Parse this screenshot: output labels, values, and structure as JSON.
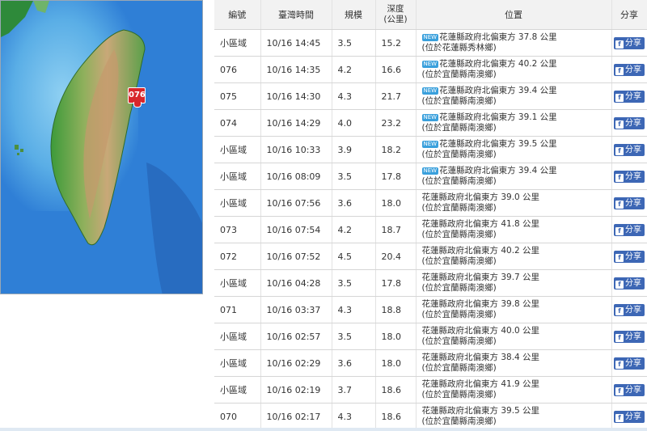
{
  "map": {
    "marker_label": "076",
    "colors": {
      "sea": "#2f7fd6",
      "shallow": "#7cc3ee",
      "lowland": "#3d9a3a",
      "highland": "#c9a878",
      "marker": "#d8262b"
    }
  },
  "table": {
    "headers": {
      "id": "編號",
      "time": "臺灣時間",
      "magnitude": "規模",
      "depth_line1": "深度",
      "depth_line2": "(公里)",
      "location": "位置",
      "share": "分享"
    },
    "new_badge_text": "NEW",
    "share_label": "分享",
    "rows": [
      {
        "id": "小區域",
        "time": "10/16 14:45",
        "magnitude": "3.5",
        "depth": "15.2",
        "loc1": "花蓮縣政府北偏東方 37.8 公里",
        "loc2": "(位於花蓮縣秀林鄉)",
        "is_new": true
      },
      {
        "id": "076",
        "time": "10/16 14:35",
        "magnitude": "4.2",
        "depth": "16.6",
        "loc1": "花蓮縣政府北偏東方 40.2 公里",
        "loc2": "(位於宜蘭縣南澳鄉)",
        "is_new": true
      },
      {
        "id": "075",
        "time": "10/16 14:30",
        "magnitude": "4.3",
        "depth": "21.7",
        "loc1": "花蓮縣政府北偏東方 39.4 公里",
        "loc2": "(位於宜蘭縣南澳鄉)",
        "is_new": true
      },
      {
        "id": "074",
        "time": "10/16 14:29",
        "magnitude": "4.0",
        "depth": "23.2",
        "loc1": "花蓮縣政府北偏東方 39.1 公里",
        "loc2": "(位於宜蘭縣南澳鄉)",
        "is_new": true
      },
      {
        "id": "小區域",
        "time": "10/16 10:33",
        "magnitude": "3.9",
        "depth": "18.2",
        "loc1": "花蓮縣政府北偏東方 39.5 公里",
        "loc2": "(位於宜蘭縣南澳鄉)",
        "is_new": true
      },
      {
        "id": "小區域",
        "time": "10/16 08:09",
        "magnitude": "3.5",
        "depth": "17.8",
        "loc1": "花蓮縣政府北偏東方 39.4 公里",
        "loc2": "(位於宜蘭縣南澳鄉)",
        "is_new": true
      },
      {
        "id": "小區域",
        "time": "10/16 07:56",
        "magnitude": "3.6",
        "depth": "18.0",
        "loc1": "花蓮縣政府北偏東方 39.0 公里",
        "loc2": "(位於宜蘭縣南澳鄉)",
        "is_new": false
      },
      {
        "id": "073",
        "time": "10/16 07:54",
        "magnitude": "4.2",
        "depth": "18.7",
        "loc1": "花蓮縣政府北偏東方 41.8 公里",
        "loc2": "(位於宜蘭縣南澳鄉)",
        "is_new": false
      },
      {
        "id": "072",
        "time": "10/16 07:52",
        "magnitude": "4.5",
        "depth": "20.4",
        "loc1": "花蓮縣政府北偏東方 40.2 公里",
        "loc2": "(位於宜蘭縣南澳鄉)",
        "is_new": false
      },
      {
        "id": "小區域",
        "time": "10/16 04:28",
        "magnitude": "3.5",
        "depth": "17.8",
        "loc1": "花蓮縣政府北偏東方 39.7 公里",
        "loc2": "(位於宜蘭縣南澳鄉)",
        "is_new": false
      },
      {
        "id": "071",
        "time": "10/16 03:37",
        "magnitude": "4.3",
        "depth": "18.8",
        "loc1": "花蓮縣政府北偏東方 39.8 公里",
        "loc2": "(位於宜蘭縣南澳鄉)",
        "is_new": false
      },
      {
        "id": "小區域",
        "time": "10/16 02:57",
        "magnitude": "3.5",
        "depth": "18.0",
        "loc1": "花蓮縣政府北偏東方 40.0 公里",
        "loc2": "(位於宜蘭縣南澳鄉)",
        "is_new": false
      },
      {
        "id": "小區域",
        "time": "10/16 02:29",
        "magnitude": "3.6",
        "depth": "18.0",
        "loc1": "花蓮縣政府北偏東方 38.4 公里",
        "loc2": "(位於宜蘭縣南澳鄉)",
        "is_new": false
      },
      {
        "id": "小區域",
        "time": "10/16 02:19",
        "magnitude": "3.7",
        "depth": "18.6",
        "loc1": "花蓮縣政府北偏東方 41.9 公里",
        "loc2": "(位於宜蘭縣南澳鄉)",
        "is_new": false
      },
      {
        "id": "070",
        "time": "10/16 02:17",
        "magnitude": "4.3",
        "depth": "18.6",
        "loc1": "花蓮縣政府北偏東方 39.5 公里",
        "loc2": "(位於宜蘭縣南澳鄉)",
        "is_new": false
      }
    ]
  }
}
